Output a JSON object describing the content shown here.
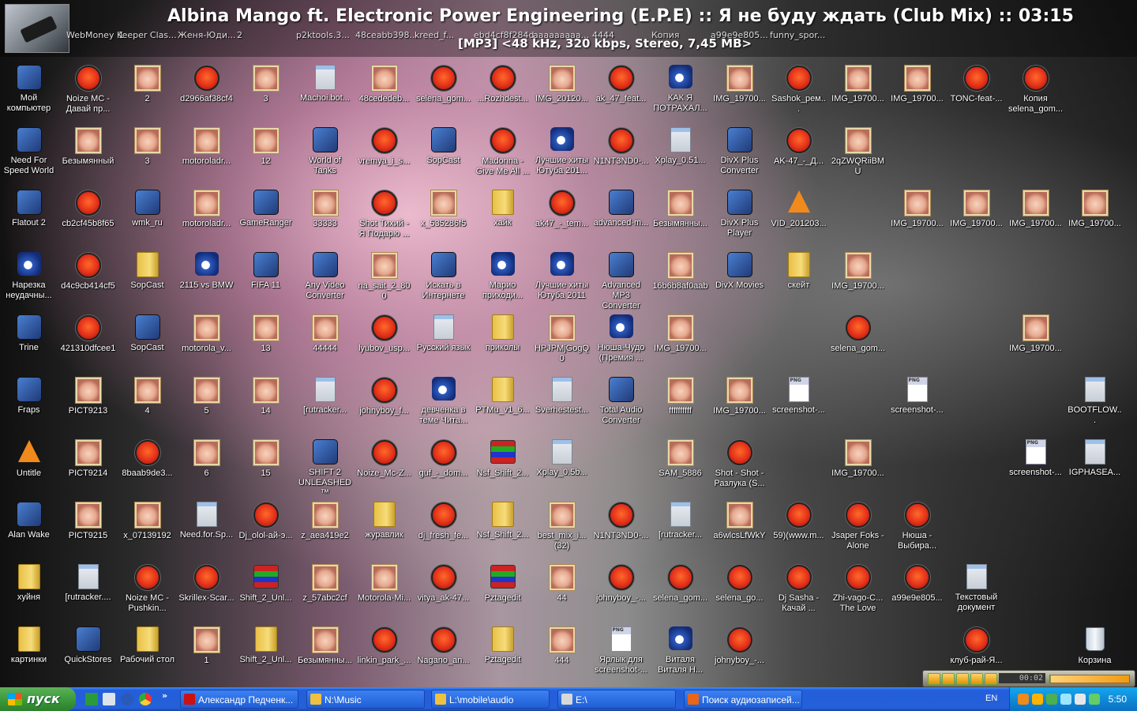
{
  "osd": {
    "title": "Albina Mango ft. Electronic Power Engineering (E.P.E) :: Я не буду ждать (Club Mix) :: 03:15",
    "subtitle": "[MP3] <48 kHz, 320 kbps, Stereo, 7,45 MB>",
    "ghost_labels": [
      "WebMoney Keeper Clas...",
      "1",
      "Женя-Юди...",
      "2",
      "p2ktools.3...",
      "48ceabb398...",
      "kreed_f...",
      "ebd4cf8f284d",
      "aaaaaaaaa...",
      "4444",
      "Копия",
      "a99e9e805...",
      "funny_spor..."
    ]
  },
  "desktop": {
    "icons": [
      {
        "col": 0,
        "row": 1,
        "type": "app",
        "label": "Мой компьютер"
      },
      {
        "col": 1,
        "row": 1,
        "type": "mp3",
        "label": "Noize MC - Давай пр..."
      },
      {
        "col": 2,
        "row": 1,
        "type": "photo",
        "label": "2"
      },
      {
        "col": 3,
        "row": 1,
        "type": "mp3",
        "label": "d2966af38cf4"
      },
      {
        "col": 4,
        "row": 1,
        "type": "photo",
        "label": "3"
      },
      {
        "col": 5,
        "row": 1,
        "type": "doc",
        "label": "Machoi.bot..."
      },
      {
        "col": 6,
        "row": 1,
        "type": "photo",
        "label": "48cededeb..."
      },
      {
        "col": 7,
        "row": 1,
        "type": "mp3",
        "label": "selena_gom..."
      },
      {
        "col": 8,
        "row": 1,
        "type": "mp3",
        "label": "...Rozhdest..."
      },
      {
        "col": 9,
        "row": 1,
        "type": "photo",
        "label": "IMG_20120..."
      },
      {
        "col": 10,
        "row": 1,
        "type": "mp3",
        "label": "ak_47_feat..."
      },
      {
        "col": 11,
        "row": 1,
        "type": "vid",
        "label": "КАК Я ПОТРАХАЛ..."
      },
      {
        "col": 12,
        "row": 1,
        "type": "photo",
        "label": "IMG_19700..."
      },
      {
        "col": 13,
        "row": 1,
        "type": "mp3",
        "label": "Sashok_рем..."
      },
      {
        "col": 14,
        "row": 1,
        "type": "photo",
        "label": "IMG_19700..."
      },
      {
        "col": 15,
        "row": 1,
        "type": "photo",
        "label": "IMG_19700..."
      },
      {
        "col": 16,
        "row": 1,
        "type": "mp3",
        "label": "TONC-feat-..."
      },
      {
        "col": 17,
        "row": 1,
        "type": "mp3",
        "label": "Копия selena_gom..."
      },
      {
        "col": 0,
        "row": 2,
        "type": "app",
        "label": "Need For Speed World"
      },
      {
        "col": 1,
        "row": 2,
        "type": "photo",
        "label": "Безымянный"
      },
      {
        "col": 2,
        "row": 2,
        "type": "photo",
        "label": "3"
      },
      {
        "col": 3,
        "row": 2,
        "type": "photo",
        "label": "motoroladr..."
      },
      {
        "col": 4,
        "row": 2,
        "type": "photo",
        "label": "12"
      },
      {
        "col": 5,
        "row": 2,
        "type": "app",
        "label": "World of Tanks"
      },
      {
        "col": 6,
        "row": 2,
        "type": "mp3",
        "label": "vremya_i_s..."
      },
      {
        "col": 7,
        "row": 2,
        "type": "app",
        "label": "SopCast"
      },
      {
        "col": 8,
        "row": 2,
        "type": "mp3",
        "label": "Madonna - Give Me All ..."
      },
      {
        "col": 9,
        "row": 2,
        "type": "vid",
        "label": "Лучшие хиты Ютуба 201..."
      },
      {
        "col": 10,
        "row": 2,
        "type": "mp3",
        "label": "N1NT3ND0-..."
      },
      {
        "col": 11,
        "row": 2,
        "type": "doc",
        "label": "Xplay_0.51..."
      },
      {
        "col": 12,
        "row": 2,
        "type": "app",
        "label": "DivX Plus Converter"
      },
      {
        "col": 13,
        "row": 2,
        "type": "mp3",
        "label": "AK-47_-_Д..."
      },
      {
        "col": 14,
        "row": 2,
        "type": "photo",
        "label": "2qZWQRiiBMU"
      },
      {
        "col": 0,
        "row": 3,
        "type": "app",
        "label": "Flatout 2"
      },
      {
        "col": 1,
        "row": 3,
        "type": "mp3",
        "label": "cb2cf45b8f65"
      },
      {
        "col": 2,
        "row": 3,
        "type": "app",
        "label": "wmk_ru"
      },
      {
        "col": 3,
        "row": 3,
        "type": "photo",
        "label": "motoroladr..."
      },
      {
        "col": 4,
        "row": 3,
        "type": "app",
        "label": "GameRanger"
      },
      {
        "col": 5,
        "row": 3,
        "type": "photo",
        "label": "33333"
      },
      {
        "col": 6,
        "row": 3,
        "type": "mp3",
        "label": "Shot Тихий - Я Подарю ..."
      },
      {
        "col": 7,
        "row": 3,
        "type": "photo",
        "label": "x_535286f5"
      },
      {
        "col": 8,
        "row": 3,
        "type": "folder",
        "label": "хайк"
      },
      {
        "col": 9,
        "row": 3,
        "type": "mp3",
        "label": "ak47_-_tem..."
      },
      {
        "col": 10,
        "row": 3,
        "type": "app",
        "label": "advanced-m..."
      },
      {
        "col": 11,
        "row": 3,
        "type": "photo",
        "label": "Безымянны..."
      },
      {
        "col": 12,
        "row": 3,
        "type": "app",
        "label": "DivX Plus Player"
      },
      {
        "col": 13,
        "row": 3,
        "type": "vlc",
        "label": "VID_201203..."
      },
      {
        "col": 15,
        "row": 3,
        "type": "photo",
        "label": "IMG_19700..."
      },
      {
        "col": 16,
        "row": 3,
        "type": "photo",
        "label": "IMG_19700..."
      },
      {
        "col": 17,
        "row": 3,
        "type": "photo",
        "label": "IMG_19700..."
      },
      {
        "col": 18,
        "row": 3,
        "type": "photo",
        "label": "IMG_19700..."
      },
      {
        "col": 0,
        "row": 4,
        "type": "vid",
        "label": "Нарезка неудачны..."
      },
      {
        "col": 1,
        "row": 4,
        "type": "mp3",
        "label": "d4c9cb414cf5"
      },
      {
        "col": 2,
        "row": 4,
        "type": "folder",
        "label": "SopCast"
      },
      {
        "col": 3,
        "row": 4,
        "type": "vid",
        "label": "2115 vs BMW"
      },
      {
        "col": 4,
        "row": 4,
        "type": "app",
        "label": "FIFA 11"
      },
      {
        "col": 5,
        "row": 4,
        "type": "app",
        "label": "Any Video Converter"
      },
      {
        "col": 6,
        "row": 4,
        "type": "photo",
        "label": "na_sait_2_800"
      },
      {
        "col": 7,
        "row": 4,
        "type": "app",
        "label": "Искать в Интернете"
      },
      {
        "col": 8,
        "row": 4,
        "type": "vid",
        "label": "Марио приходи..."
      },
      {
        "col": 9,
        "row": 4,
        "type": "vid",
        "label": "Лучшие хиты Ютуба 2011"
      },
      {
        "col": 10,
        "row": 4,
        "type": "app",
        "label": "Advanced MP3 Converter"
      },
      {
        "col": 11,
        "row": 4,
        "type": "photo",
        "label": "16b6b8af0aab"
      },
      {
        "col": 12,
        "row": 4,
        "type": "app",
        "label": "DivX Movies"
      },
      {
        "col": 13,
        "row": 4,
        "type": "folder",
        "label": "скейт"
      },
      {
        "col": 14,
        "row": 4,
        "type": "photo",
        "label": "IMG_19700..."
      },
      {
        "col": 0,
        "row": 5,
        "type": "app",
        "label": "Trine"
      },
      {
        "col": 1,
        "row": 5,
        "type": "mp3",
        "label": "421310dfcee1"
      },
      {
        "col": 2,
        "row": 5,
        "type": "app",
        "label": "SopCast"
      },
      {
        "col": 3,
        "row": 5,
        "type": "photo",
        "label": "motorola_v..."
      },
      {
        "col": 4,
        "row": 5,
        "type": "photo",
        "label": "13"
      },
      {
        "col": 5,
        "row": 5,
        "type": "photo",
        "label": "44444"
      },
      {
        "col": 6,
        "row": 5,
        "type": "mp3",
        "label": "lyubov_usp..."
      },
      {
        "col": 7,
        "row": 5,
        "type": "doc",
        "label": "Русский язык"
      },
      {
        "col": 8,
        "row": 5,
        "type": "folder",
        "label": "приколы"
      },
      {
        "col": 9,
        "row": 5,
        "type": "photo",
        "label": "HPJPMjGogQ0"
      },
      {
        "col": 10,
        "row": 5,
        "type": "vid",
        "label": "Нюша-Чудо (Премия ..."
      },
      {
        "col": 11,
        "row": 5,
        "type": "photo",
        "label": "IMG_19700..."
      },
      {
        "col": 14,
        "row": 5,
        "type": "mp3",
        "label": "selena_gom..."
      },
      {
        "col": 17,
        "row": 5,
        "type": "photo",
        "label": "IMG_19700..."
      },
      {
        "col": 0,
        "row": 6,
        "type": "app",
        "label": "Fraps"
      },
      {
        "col": 1,
        "row": 6,
        "type": "photo",
        "label": "PICT9213"
      },
      {
        "col": 2,
        "row": 6,
        "type": "photo",
        "label": "4"
      },
      {
        "col": 3,
        "row": 6,
        "type": "photo",
        "label": "5"
      },
      {
        "col": 4,
        "row": 6,
        "type": "photo",
        "label": "14"
      },
      {
        "col": 5,
        "row": 6,
        "type": "doc",
        "label": "[rutracker..."
      },
      {
        "col": 6,
        "row": 6,
        "type": "mp3",
        "label": "johnyboy_f..."
      },
      {
        "col": 7,
        "row": 6,
        "type": "vid",
        "label": "девченка в теме Чита..."
      },
      {
        "col": 8,
        "row": 6,
        "type": "folder",
        "label": "PTMu_v1_6..."
      },
      {
        "col": 9,
        "row": 6,
        "type": "doc",
        "label": "Sverhestest..."
      },
      {
        "col": 10,
        "row": 6,
        "type": "app",
        "label": "Total Audio Converter"
      },
      {
        "col": 11,
        "row": 6,
        "type": "photo",
        "label": "ffffffffff"
      },
      {
        "col": 12,
        "row": 6,
        "type": "photo",
        "label": "IMG_19700..."
      },
      {
        "col": 13,
        "row": 6,
        "type": "png",
        "label": "screenshot-..."
      },
      {
        "col": 15,
        "row": 6,
        "type": "png",
        "label": "screenshot-..."
      },
      {
        "col": 18,
        "row": 6,
        "type": "doc",
        "label": "BOOTFLOW..."
      },
      {
        "col": 0,
        "row": 7,
        "type": "vlc",
        "label": "Untitle"
      },
      {
        "col": 1,
        "row": 7,
        "type": "photo",
        "label": "PICT9214"
      },
      {
        "col": 2,
        "row": 7,
        "type": "mp3",
        "label": "8baab9de3..."
      },
      {
        "col": 3,
        "row": 7,
        "type": "photo",
        "label": "6"
      },
      {
        "col": 4,
        "row": 7,
        "type": "photo",
        "label": "15"
      },
      {
        "col": 5,
        "row": 7,
        "type": "app",
        "label": "SHIFT 2 UNLEASHED™"
      },
      {
        "col": 6,
        "row": 7,
        "type": "mp3",
        "label": "Noize_Mc-Z..."
      },
      {
        "col": 7,
        "row": 7,
        "type": "mp3",
        "label": "guf_-_dom..."
      },
      {
        "col": 8,
        "row": 7,
        "type": "rar",
        "label": "Nsf_Shift_2..."
      },
      {
        "col": 9,
        "row": 7,
        "type": "doc",
        "label": "Xplay_0.5b..."
      },
      {
        "col": 11,
        "row": 7,
        "type": "photo",
        "label": "SAM_5886"
      },
      {
        "col": 12,
        "row": 7,
        "type": "mp3",
        "label": "Shot - Shot - Разлука (S..."
      },
      {
        "col": 14,
        "row": 7,
        "type": "photo",
        "label": "IMG_19700..."
      },
      {
        "col": 17,
        "row": 7,
        "type": "png",
        "label": "screenshot-..."
      },
      {
        "col": 18,
        "row": 7,
        "type": "doc",
        "label": "IGPHASEA..."
      },
      {
        "col": 0,
        "row": 8,
        "type": "app",
        "label": "Alan Wake"
      },
      {
        "col": 1,
        "row": 8,
        "type": "photo",
        "label": "PICT9215"
      },
      {
        "col": 2,
        "row": 8,
        "type": "photo",
        "label": "x_07139192"
      },
      {
        "col": 3,
        "row": 8,
        "type": "doc",
        "label": "Need.for.Sp..."
      },
      {
        "col": 4,
        "row": 8,
        "type": "mp3",
        "label": "Dj_olol-ай-э..."
      },
      {
        "col": 5,
        "row": 8,
        "type": "photo",
        "label": "z_aea419e2"
      },
      {
        "col": 6,
        "row": 8,
        "type": "folder",
        "label": "журавлик"
      },
      {
        "col": 7,
        "row": 8,
        "type": "mp3",
        "label": "dj_fresh_fe..."
      },
      {
        "col": 8,
        "row": 8,
        "type": "folder",
        "label": "Nsf_Shift_2..."
      },
      {
        "col": 9,
        "row": 8,
        "type": "photo",
        "label": "best_mix_i... (32)"
      },
      {
        "col": 10,
        "row": 8,
        "type": "mp3",
        "label": "N1NT3ND0-..."
      },
      {
        "col": 11,
        "row": 8,
        "type": "doc",
        "label": "[rutracker..."
      },
      {
        "col": 12,
        "row": 8,
        "type": "photo",
        "label": "a6wlcsLfWkY"
      },
      {
        "col": 13,
        "row": 8,
        "type": "mp3",
        "label": "59)(www.m..."
      },
      {
        "col": 14,
        "row": 8,
        "type": "mp3",
        "label": "Jsaper Foks - Alone"
      },
      {
        "col": 15,
        "row": 8,
        "type": "mp3",
        "label": "Нюша - Выбира..."
      },
      {
        "col": 0,
        "row": 9,
        "type": "folder",
        "label": "хуйня"
      },
      {
        "col": 1,
        "row": 9,
        "type": "doc",
        "label": "[rutracker...."
      },
      {
        "col": 2,
        "row": 9,
        "type": "mp3",
        "label": "Noize MC - Pushkin..."
      },
      {
        "col": 3,
        "row": 9,
        "type": "mp3",
        "label": "Skrillex-Scar..."
      },
      {
        "col": 4,
        "row": 9,
        "type": "rar",
        "label": "Shift_2_Unl..."
      },
      {
        "col": 5,
        "row": 9,
        "type": "photo",
        "label": "z_57abc2cf"
      },
      {
        "col": 6,
        "row": 9,
        "type": "photo",
        "label": "Motorola-Mi..."
      },
      {
        "col": 7,
        "row": 9,
        "type": "mp3",
        "label": "vitya_ak-47..."
      },
      {
        "col": 8,
        "row": 9,
        "type": "rar",
        "label": "Pztagedit"
      },
      {
        "col": 9,
        "row": 9,
        "type": "photo",
        "label": "44"
      },
      {
        "col": 10,
        "row": 9,
        "type": "mp3",
        "label": "johnyboy_-..."
      },
      {
        "col": 11,
        "row": 9,
        "type": "mp3",
        "label": "selena_gom..."
      },
      {
        "col": 12,
        "row": 9,
        "type": "mp3",
        "label": "selena_go..."
      },
      {
        "col": 13,
        "row": 9,
        "type": "mp3",
        "label": "Dj Sasha - Качай ..."
      },
      {
        "col": 14,
        "row": 9,
        "type": "mp3",
        "label": "Zhi-vago-C... The Love"
      },
      {
        "col": 15,
        "row": 9,
        "type": "mp3",
        "label": "a99e9e805..."
      },
      {
        "col": 16,
        "row": 9,
        "type": "doc",
        "label": "Текстовый документ"
      },
      {
        "col": 0,
        "row": 10,
        "type": "folder",
        "label": "картинки"
      },
      {
        "col": 1,
        "row": 10,
        "type": "app",
        "label": "QuickStores"
      },
      {
        "col": 2,
        "row": 10,
        "type": "folder",
        "label": "Рабочий стол"
      },
      {
        "col": 3,
        "row": 10,
        "type": "photo",
        "label": "1"
      },
      {
        "col": 4,
        "row": 10,
        "type": "folder",
        "label": "Shift_2_Unl..."
      },
      {
        "col": 5,
        "row": 10,
        "type": "photo",
        "label": "Безымянны..."
      },
      {
        "col": 6,
        "row": 10,
        "type": "mp3",
        "label": "linkin_park_..."
      },
      {
        "col": 7,
        "row": 10,
        "type": "mp3",
        "label": "Nagano_an..."
      },
      {
        "col": 8,
        "row": 10,
        "type": "folder",
        "label": "Pztagedit"
      },
      {
        "col": 9,
        "row": 10,
        "type": "photo",
        "label": "444"
      },
      {
        "col": 10,
        "row": 10,
        "type": "png",
        "label": "Ярлык для screenshot-..."
      },
      {
        "col": 11,
        "row": 10,
        "type": "vid",
        "label": "Виталя Виталя Н..."
      },
      {
        "col": 12,
        "row": 10,
        "type": "mp3",
        "label": "johnyboy_-..."
      },
      {
        "col": 16,
        "row": 10,
        "type": "mp3",
        "label": "клуб-рай-Я..."
      },
      {
        "col": 18,
        "row": 10,
        "type": "trash",
        "label": "Корзина"
      }
    ]
  },
  "player": {
    "time": "00:02",
    "progress": 0.01
  },
  "taskbar": {
    "start_label": "пуск",
    "tasks": [
      {
        "label": "Александр Педченк...",
        "icon_color": "#cc1111"
      },
      {
        "label": "N:\\Music",
        "icon_color": "#f0c040"
      },
      {
        "label": "L:\\mobile\\audio",
        "icon_color": "#f0c040"
      },
      {
        "label": "E:\\",
        "icon_color": "#d8d8d8"
      },
      {
        "label": "Поиск аудиозаписей...",
        "icon_color": "#e8661a"
      }
    ],
    "lang": "EN",
    "clock": "5:50"
  }
}
